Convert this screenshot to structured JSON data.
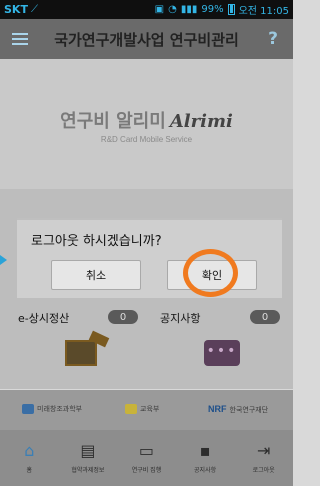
{
  "status_bar": {
    "carrier": "SKT",
    "carrier_icon": "wifi-icon",
    "battery": "99%",
    "time": "오전 11:05"
  },
  "app_bar": {
    "title": "국가연구개발사업 연구비관리",
    "help": "?"
  },
  "banner": {
    "brand": "연구비 알리미",
    "brand_en": "Alrimi",
    "subtitle": "R&D Card Mobile Service"
  },
  "dialog": {
    "message": "로그아웃 하시겠습니까?",
    "cancel_label": "취소",
    "confirm_label": "확인",
    "highlight_color": "#f07a1f"
  },
  "tiles": {
    "left_label": "e-상시정산",
    "left_count": "0",
    "right_label": "공지사항",
    "right_count": "0"
  },
  "logos": {
    "first": "미래창조과학부",
    "second": "교육부",
    "third": "한국연구재단",
    "third_mark": "NRF"
  },
  "bottom_nav": {
    "items": [
      {
        "label": "홈",
        "icon": "home-icon"
      },
      {
        "label": "협약과제정보",
        "icon": "document-icon"
      },
      {
        "label": "연구비 집행",
        "icon": "card-icon"
      },
      {
        "label": "공지사항",
        "icon": "chat-icon"
      },
      {
        "label": "로그아웃",
        "icon": "logout-icon"
      }
    ]
  }
}
